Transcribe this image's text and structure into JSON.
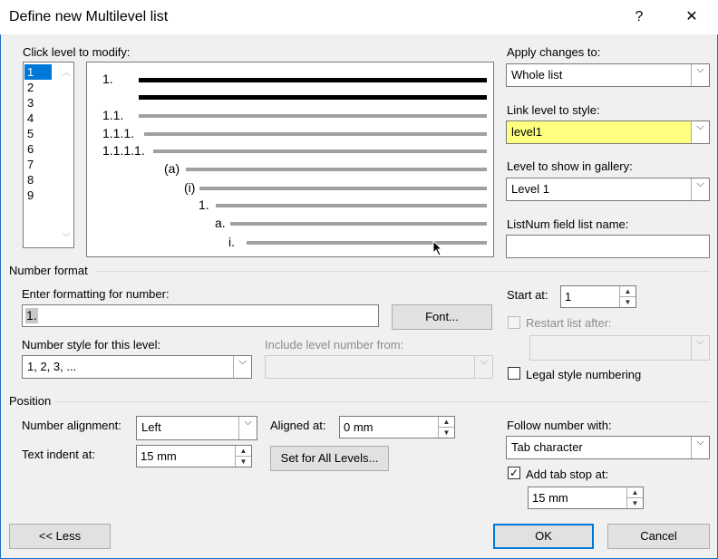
{
  "window": {
    "title": "Define new Multilevel list",
    "help_label": "?",
    "close_label": "✕"
  },
  "levels": {
    "label": "Click level to modify:",
    "items": [
      "1",
      "2",
      "3",
      "4",
      "5",
      "6",
      "7",
      "8",
      "9"
    ],
    "selected": "1"
  },
  "preview": {
    "numbers": [
      "1.",
      "1.1.",
      "1.1.1.",
      "1.1.1.1.",
      "(a)",
      "(i)",
      "1.",
      "a.",
      "i."
    ]
  },
  "apply_changes": {
    "label": "Apply changes to:",
    "value": "Whole list"
  },
  "link_style": {
    "label": "Link level to style:",
    "value": "level1",
    "highlight_color": "#ffff80"
  },
  "gallery_level": {
    "label": "Level to show in gallery:",
    "value": "Level 1"
  },
  "listnum": {
    "label": "ListNum field list name:",
    "value": ""
  },
  "number_format": {
    "section_label": "Number format",
    "enter_label": "Enter formatting for number:",
    "format_value": "1.",
    "font_button": "Font...",
    "style_label": "Number style for this level:",
    "style_value": "1, 2, 3, ...",
    "include_label": "Include level number from:",
    "include_value": "",
    "start_at_label": "Start at:",
    "start_at_value": "1",
    "restart_label": "Restart list after:",
    "restart_value": "",
    "legal_label": "Legal style numbering"
  },
  "position": {
    "section_label": "Position",
    "alignment_label": "Number alignment:",
    "alignment_value": "Left",
    "aligned_at_label": "Aligned at:",
    "aligned_at_value": "0 mm",
    "indent_label": "Text indent at:",
    "indent_value": "15 mm",
    "set_all_button": "Set for All Levels...",
    "follow_label": "Follow number with:",
    "follow_value": "Tab character",
    "tab_stop_label": "Add tab stop at:",
    "tab_stop_value": "15 mm"
  },
  "footer": {
    "less_button": "<< Less",
    "ok_button": "OK",
    "cancel_button": "Cancel"
  }
}
